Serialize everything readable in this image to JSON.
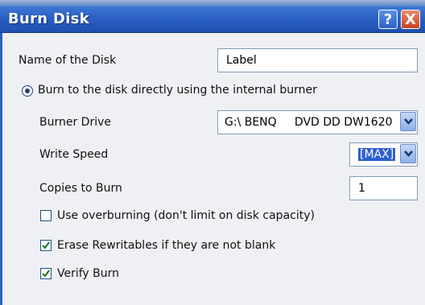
{
  "window": {
    "title": "Burn Disk",
    "help_button": "?",
    "close_button": "X"
  },
  "disk_name": {
    "label": "Name of the Disk",
    "value": "Label"
  },
  "burn_mode": {
    "label": "Burn to the disk directly using the internal burner",
    "selected": true
  },
  "burner_drive": {
    "label": "Burner Drive",
    "value": "G:\\ BENQ     DVD DD DW1620"
  },
  "write_speed": {
    "label": "Write Speed",
    "value": "[MAX]"
  },
  "copies": {
    "label": "Copies to Burn",
    "value": "1"
  },
  "options": [
    {
      "label": "Use overburning (don't limit on disk capacity)",
      "checked": false
    },
    {
      "label": "Erase Rewritables if they are not blank",
      "checked": true
    },
    {
      "label": "Verify Burn",
      "checked": true
    }
  ],
  "colors": {
    "titlebar": "#2a5fc4",
    "selection": "#2f5fd0",
    "background": "#eef0f3"
  }
}
